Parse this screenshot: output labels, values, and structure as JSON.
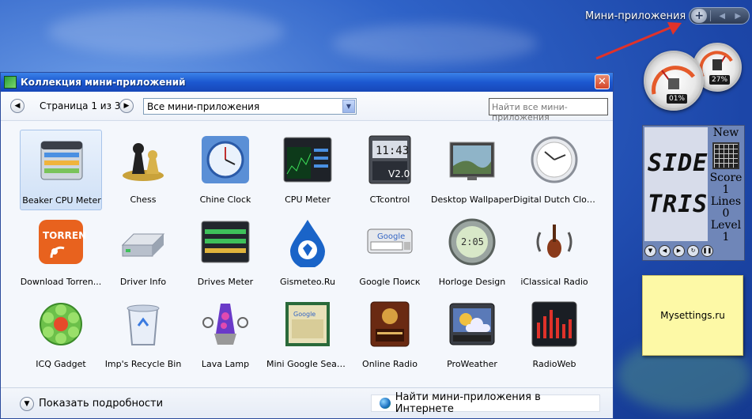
{
  "sidebar": {
    "title": "Мини-приложения"
  },
  "gauges": {
    "cpu_percent": "01%",
    "memory_percent": "27%"
  },
  "tetris": {
    "line1": "SIDE",
    "line2": "TRIS",
    "new_label": "New",
    "score_label": "Score",
    "score_value": "1",
    "lines_label": "Lines",
    "lines_value": "0",
    "level_label": "Level",
    "level_value": "1"
  },
  "note": {
    "text": "Mysettings.ru"
  },
  "dialog": {
    "title": "Коллекция мини-приложений",
    "page_label": "Страница 1 из 3",
    "category_value": "Все мини-приложения",
    "search_placeholder": "Найти все мини-приложения",
    "details_label": "Показать подробности",
    "online_label": "Найти мини-приложения в Интернете",
    "gadgets": [
      {
        "label": "Beaker CPU Meter",
        "icon": "beaker-cpu-meter-icon",
        "selected": true
      },
      {
        "label": "Chess",
        "icon": "chess-icon"
      },
      {
        "label": "Chine Clock",
        "icon": "chine-clock-icon"
      },
      {
        "label": "CPU Meter",
        "icon": "cpu-meter-icon"
      },
      {
        "label": "CTcontrol",
        "icon": "ctcontrol-icon"
      },
      {
        "label": "Desktop Wallpaper",
        "icon": "desktop-wallpaper-icon"
      },
      {
        "label": "Digital Dutch Clock",
        "icon": "digital-dutch-clock-icon"
      },
      {
        "label": "Download Torren...",
        "icon": "download-torrent-icon"
      },
      {
        "label": "Driver Info",
        "icon": "driver-info-icon"
      },
      {
        "label": "Drives Meter",
        "icon": "drives-meter-icon"
      },
      {
        "label": "Gismeteo.Ru",
        "icon": "gismeteo-icon"
      },
      {
        "label": "Google Поиск",
        "icon": "google-search-icon"
      },
      {
        "label": "Horloge Design",
        "icon": "horloge-design-icon"
      },
      {
        "label": "iClassical Radio",
        "icon": "iclassical-radio-icon"
      },
      {
        "label": "ICQ Gadget",
        "icon": "icq-icon"
      },
      {
        "label": "Imp's Recycle Bin",
        "icon": "recycle-bin-icon"
      },
      {
        "label": "Lava Lamp",
        "icon": "lava-lamp-icon"
      },
      {
        "label": "Mini Google Search",
        "icon": "mini-google-search-icon"
      },
      {
        "label": "Online Radio",
        "icon": "online-radio-icon"
      },
      {
        "label": "ProWeather",
        "icon": "proweather-icon"
      },
      {
        "label": "RadioWeb",
        "icon": "radioweb-icon"
      }
    ]
  },
  "colors": {
    "accent": "#1c58d0",
    "selection": "#cfe0f6",
    "arrow": "#e0322a"
  }
}
